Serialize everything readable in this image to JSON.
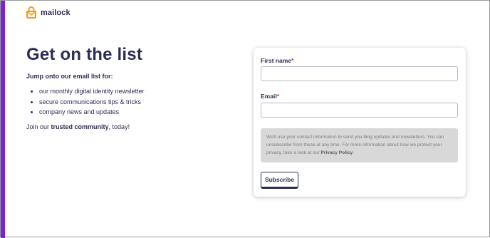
{
  "brand": {
    "name": "mailock",
    "logo_icon": "mailock-logo-icon",
    "logo_color": "#f39c12"
  },
  "colors": {
    "accent_bar": "#7a22d6",
    "text_primary": "#2c2d55",
    "consent_bg": "#d8d8d8",
    "required_marker": "#c0392b"
  },
  "hero": {
    "title": "Get on the list",
    "intro": "Jump onto our email list for:",
    "bullets": [
      "our monthly digital identity newsletter",
      "secure communications tips & tricks",
      "company news and updates"
    ],
    "outro_prefix": "Join our ",
    "outro_bold": "trusted community",
    "outro_suffix": ", today!"
  },
  "form": {
    "first_name": {
      "label": "First name",
      "required_marker": "*",
      "value": "",
      "placeholder": ""
    },
    "email": {
      "label": "Email",
      "required_marker": "*",
      "value": "",
      "placeholder": ""
    },
    "consent": {
      "text_before": "We'll use your contact information to send you blog updates and newsletters. You can unsubscribe from these at any time. For more information about how we protect your privacy, take a look at our ",
      "link_text": "Privacy Policy",
      "text_after": "."
    },
    "submit_label": "Subscribe"
  }
}
